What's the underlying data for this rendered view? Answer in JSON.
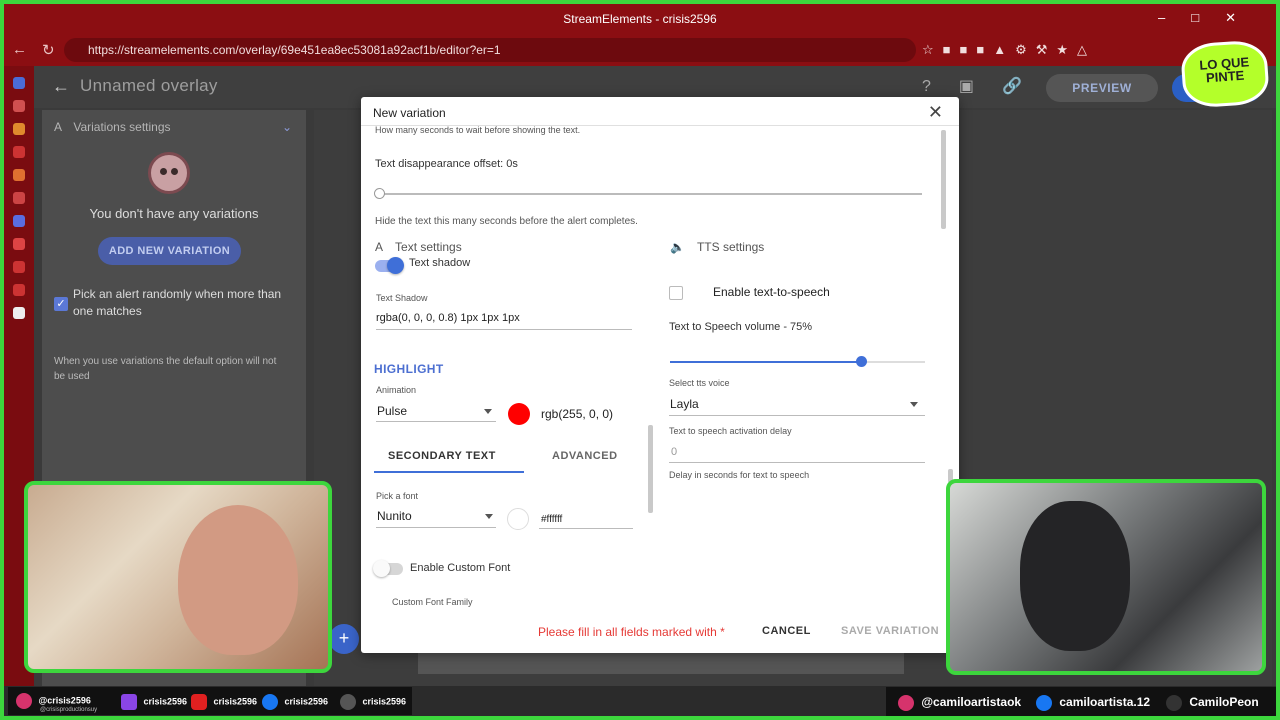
{
  "browser": {
    "window_title": "StreamElements - crisis2596",
    "url": "https://streamelements.com/overlay/69e451ea8ec53081a92acf1b/editor?er=1"
  },
  "app": {
    "overlay_title": "Unnamed overlay",
    "preview_label": "PREVIEW"
  },
  "variations": {
    "header": "Variations settings",
    "empty_text": "You don't have any variations",
    "add_button": "ADD NEW VARIATION",
    "random_pick_label": "Pick an alert randomly when more than one matches",
    "random_pick_checked": true,
    "note": "When you use variations the default option will not be used"
  },
  "modal": {
    "title": "New variation",
    "top_help": "How many seconds to wait before showing the text.",
    "disappear_label": "Text disappearance offset: 0s",
    "disappear_help": "Hide the text this many seconds before the alert completes.",
    "tabs": [
      "Text settings",
      "TTS settings"
    ],
    "text_shadow_toggle": "Text shadow",
    "text_shadow_field_label": "Text Shadow",
    "text_shadow_value": "rgba(0, 0, 0, 0.8) 1px 1px 1px",
    "highlight_header": "HIGHLIGHT",
    "animation_label": "Animation",
    "animation_value": "Pulse",
    "highlight_color_hex": "#ff0000",
    "highlight_color_text": "rgb(255, 0, 0)",
    "subtabs": [
      "SECONDARY TEXT",
      "ADVANCED"
    ],
    "font_label": "Pick a font",
    "font_value": "Nunito",
    "font_color_text": "#ffffff",
    "custom_font_toggle": "Enable Custom Font",
    "custom_font_family_label": "Custom Font Family",
    "tts_enable_label": "Enable text-to-speech",
    "tts_volume_label": "Text to Speech volume - 75%",
    "tts_volume": 0.75,
    "tts_voice_label": "Select tts voice",
    "tts_voice_value": "Layla",
    "tts_delay_label": "Text to speech activation delay",
    "tts_delay_value": "0",
    "tts_delay_help": "Delay in seconds for text to speech",
    "error_text": "Please fill in all fields marked with *",
    "cancel_label": "CANCEL",
    "save_label": "SAVE VARIATION"
  },
  "socials_left": [
    {
      "icon": "instagram-icon",
      "handle": "@crisis2596",
      "sub": "@crisisproductionsuy"
    },
    {
      "icon": "twitch-icon",
      "handle": "crisis2596"
    },
    {
      "icon": "youtube-icon",
      "handle": "crisis2596"
    },
    {
      "icon": "facebook-icon",
      "handle": "crisis2596"
    },
    {
      "icon": "threads-icon",
      "handle": "crisis2596"
    }
  ],
  "socials_right": [
    {
      "icon": "instagram-icon",
      "handle": "@camiloartistaok"
    },
    {
      "icon": "facebook-icon",
      "handle": "camiloartista.12"
    },
    {
      "icon": "x-icon",
      "handle": "CamiloPeon"
    }
  ],
  "logo_text": "LO QUE PINTE",
  "colors": {
    "frame": "#3dd63d",
    "browser_chrome": "#8b0e12",
    "accent_blue": "#3f6fd8",
    "error_red": "#e53935"
  }
}
